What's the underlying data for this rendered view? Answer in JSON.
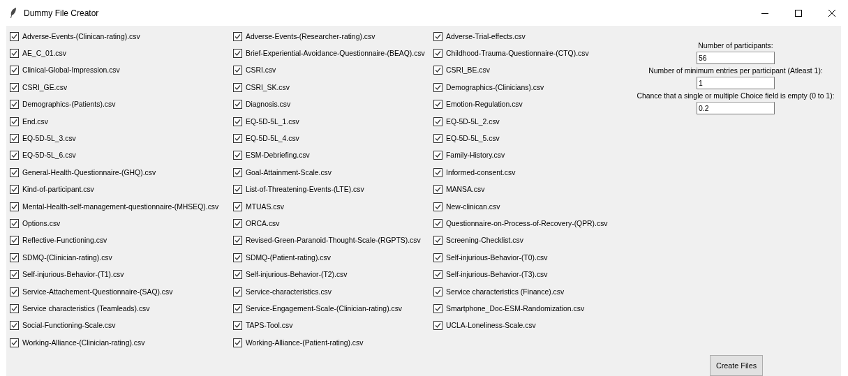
{
  "window": {
    "title": "Dummy File Creator"
  },
  "files": [
    {
      "label": "Adverse-Events-(Clinican-rating).csv",
      "checked": true
    },
    {
      "label": "Adverse-Events-(Researcher-rating).csv",
      "checked": true
    },
    {
      "label": "Adverse-Trial-effects.csv",
      "checked": true
    },
    {
      "label": "AE_C_01.csv",
      "checked": true
    },
    {
      "label": "Brief-Experiential-Avoidance-Questionnaire-(BEAQ).csv",
      "checked": true
    },
    {
      "label": "Childhood-Trauma-Questionnaire-(CTQ).csv",
      "checked": true
    },
    {
      "label": "Clinical-Global-Impression.csv",
      "checked": true
    },
    {
      "label": "CSRI.csv",
      "checked": true
    },
    {
      "label": "CSRI_BE.csv",
      "checked": true
    },
    {
      "label": "CSRI_GE.csv",
      "checked": true
    },
    {
      "label": "CSRI_SK.csv",
      "checked": true
    },
    {
      "label": "Demographics-(Clinicians).csv",
      "checked": true
    },
    {
      "label": "Demographics-(Patients).csv",
      "checked": true
    },
    {
      "label": "Diagnosis.csv",
      "checked": true
    },
    {
      "label": "Emotion-Regulation.csv",
      "checked": true
    },
    {
      "label": "End.csv",
      "checked": true
    },
    {
      "label": "EQ-5D-5L_1.csv",
      "checked": true
    },
    {
      "label": "EQ-5D-5L_2.csv",
      "checked": true
    },
    {
      "label": "EQ-5D-5L_3.csv",
      "checked": true
    },
    {
      "label": "EQ-5D-5L_4.csv",
      "checked": true
    },
    {
      "label": "EQ-5D-5L_5.csv",
      "checked": true
    },
    {
      "label": "EQ-5D-5L_6.csv",
      "checked": true
    },
    {
      "label": "ESM-Debriefing.csv",
      "checked": true
    },
    {
      "label": "Family-History.csv",
      "checked": true
    },
    {
      "label": "General-Health-Questionnaire-(GHQ).csv",
      "checked": true
    },
    {
      "label": "Goal-Attainment-Scale.csv",
      "checked": true
    },
    {
      "label": "Informed-consent.csv",
      "checked": true
    },
    {
      "label": "Kind-of-participant.csv",
      "checked": true
    },
    {
      "label": "List-of-Threatening-Events-(LTE).csv",
      "checked": true
    },
    {
      "label": "MANSA.csv",
      "checked": true
    },
    {
      "label": "Mental-Health-self-management-questionnaire-(MHSEQ).csv",
      "checked": true
    },
    {
      "label": "MTUAS.csv",
      "checked": true
    },
    {
      "label": "New-clinican.csv",
      "checked": true
    },
    {
      "label": "Options.csv",
      "checked": true
    },
    {
      "label": "ORCA.csv",
      "checked": true
    },
    {
      "label": "Questionnaire-on-Process-of-Recovery-(QPR).csv",
      "checked": true
    },
    {
      "label": "Reflective-Functioning.csv",
      "checked": true
    },
    {
      "label": "Revised-Green-Paranoid-Thought-Scale-(RGPTS).csv",
      "checked": true
    },
    {
      "label": "Screening-Checklist.csv",
      "checked": true
    },
    {
      "label": "SDMQ-(Clinician-rating).csv",
      "checked": true
    },
    {
      "label": "SDMQ-(Patient-rating).csv",
      "checked": true
    },
    {
      "label": "Self-injurious-Behavior-(T0).csv",
      "checked": true
    },
    {
      "label": "Self-injurious-Behavior-(T1).csv",
      "checked": true
    },
    {
      "label": "Self-injurious-Behavior-(T2).csv",
      "checked": true
    },
    {
      "label": "Self-injurious-Behavior-(T3).csv",
      "checked": true
    },
    {
      "label": "Service-Attachement-Questionnaire-(SAQ).csv",
      "checked": true
    },
    {
      "label": "Service-characteristics.csv",
      "checked": true
    },
    {
      "label": "Service characteristics (Finance).csv",
      "checked": true
    },
    {
      "label": "Service characteristics (Teamleads).csv",
      "checked": true
    },
    {
      "label": "Service-Engagement-Scale-(Clinician-rating).csv",
      "checked": true
    },
    {
      "label": "Smartphone_Doc-ESM-Randomization.csv",
      "checked": true
    },
    {
      "label": "Social-Functioning-Scale.csv",
      "checked": true
    },
    {
      "label": "TAPS-Tool.csv",
      "checked": true
    },
    {
      "label": "UCLA-Loneliness-Scale.csv",
      "checked": true
    },
    {
      "label": "Working-Alliance-(Clinician-rating).csv",
      "checked": true
    },
    {
      "label": "Working-Alliance-(Patient-rating).csv",
      "checked": true
    }
  ],
  "settings": [
    {
      "label": "Number of participants:",
      "value": "56"
    },
    {
      "label": "Number of  minimum entries per participant (Atleast 1):",
      "value": "1"
    },
    {
      "label": "Chance that a single or multiple Choice field is empty (0 to 1):",
      "value": "0.2"
    }
  ],
  "create_button": "Create Files"
}
